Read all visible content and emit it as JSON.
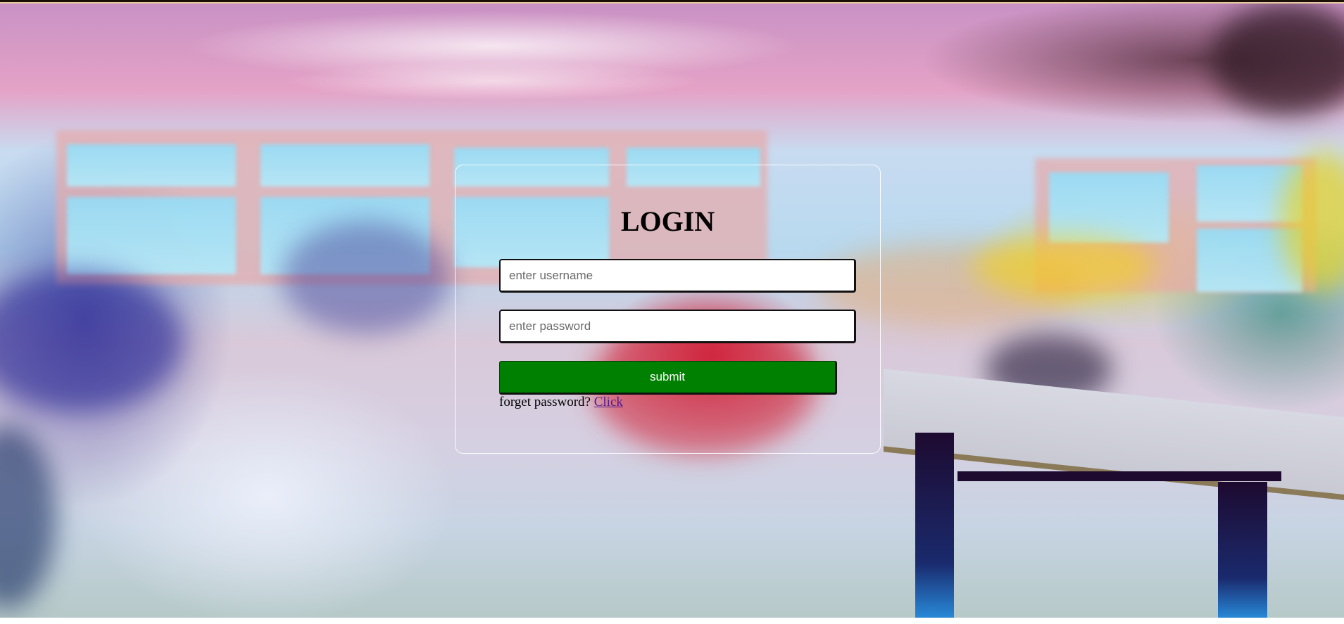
{
  "login": {
    "title": "LOGIN",
    "username_placeholder": "enter username",
    "username_value": "",
    "password_placeholder": "enter password",
    "password_value": "",
    "submit_label": "submit",
    "forgot_text": "forget password?",
    "forgot_link_label": "Click"
  },
  "colors": {
    "submit_background": "#008000",
    "submit_text": "#ffffff",
    "link_visited": "#551a8b",
    "card_border": "#ffffff"
  }
}
